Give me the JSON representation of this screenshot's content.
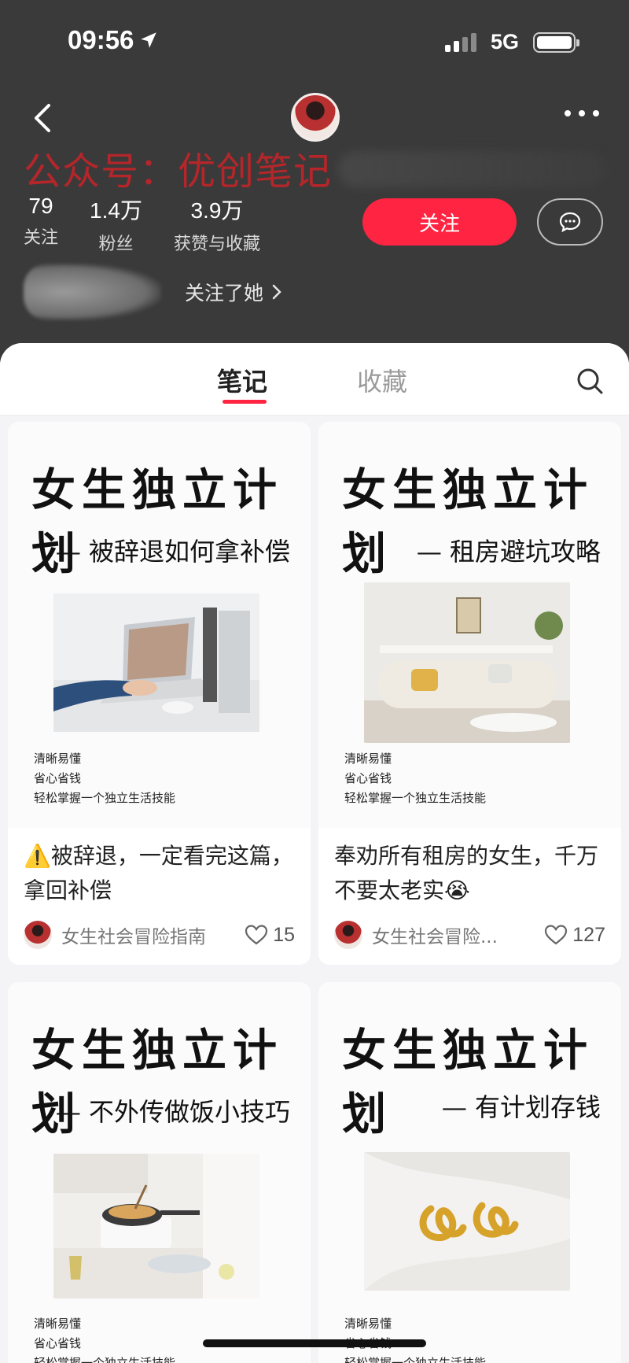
{
  "status_bar": {
    "time": "09:56",
    "network": "5G"
  },
  "profile": {
    "watermark": "公众号：优创笔记",
    "stats": [
      {
        "num": "79",
        "label": "关注"
      },
      {
        "num": "1.4万",
        "label": "粉丝"
      },
      {
        "num": "3.9万",
        "label": "获赞与收藏"
      }
    ],
    "follow_label": "关注",
    "followed_text": "关注了她"
  },
  "tabs": {
    "notes": "笔记",
    "favorites": "收藏"
  },
  "cards": [
    {
      "cover_title": "女生独立计划",
      "cover_subtitle": "— 被辞退如何拿补偿",
      "cover_lines": [
        "清晰易懂",
        "省心省钱",
        "轻松掌握一个独立生活技能"
      ],
      "title": "⚠️被辞退，一定看完这篇，拿回补偿",
      "author": "女生社会冒险指南",
      "likes": "15"
    },
    {
      "cover_title": "女生独立计划",
      "cover_subtitle": "— 租房避坑攻略",
      "cover_lines": [
        "清晰易懂",
        "省心省钱",
        "轻松掌握一个独立生活技能"
      ],
      "title": "奉劝所有租房的女生，千万不要太老实😭",
      "author": "女生社会冒险...",
      "likes": "127"
    },
    {
      "cover_title": "女生独立计划",
      "cover_subtitle": "— 不外传做饭小技巧",
      "cover_lines": [
        "清晰易懂",
        "省心省钱",
        "轻松掌握一个独立生活技能"
      ]
    },
    {
      "cover_title": "女生独立计划",
      "cover_subtitle": "— 有计划存钱",
      "cover_lines": [
        "清晰易懂",
        "省心省钱",
        "轻松掌握一个独立生活技能"
      ]
    }
  ],
  "colors": {
    "accent": "#ff2442",
    "header_bg": "#3a3a3a",
    "watermark": "#b5262a"
  },
  "icons": [
    "location-arrow-icon",
    "signal-icon",
    "battery-icon",
    "back-icon",
    "more-icon",
    "chat-icon",
    "chevron-right-icon",
    "search-icon",
    "heart-icon"
  ]
}
